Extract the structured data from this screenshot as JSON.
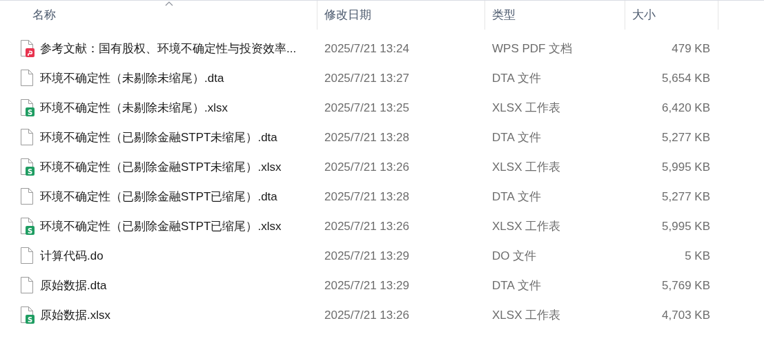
{
  "columns": [
    {
      "label": "名称",
      "sorted": true
    },
    {
      "label": "修改日期",
      "sorted": false
    },
    {
      "label": "类型",
      "sorted": false
    },
    {
      "label": "大小",
      "sorted": false
    }
  ],
  "files": [
    {
      "kind": "pdf",
      "name": "参考文献：国有股权、环境不确定性与投资效率...",
      "modified": "2025/7/21 13:24",
      "type": "WPS PDF 文档",
      "size": "479 KB"
    },
    {
      "kind": "file",
      "name": "环境不确定性（未剔除未缩尾）.dta",
      "modified": "2025/7/21 13:27",
      "type": "DTA 文件",
      "size": "5,654 KB"
    },
    {
      "kind": "sheet",
      "icon_text": "S",
      "name": "环境不确定性（未剔除未缩尾）.xlsx",
      "modified": "2025/7/21 13:25",
      "type": "XLSX 工作表",
      "size": "6,420 KB"
    },
    {
      "kind": "file",
      "name": "环境不确定性（已剔除金融STPT未缩尾）.dta",
      "modified": "2025/7/21 13:28",
      "type": "DTA 文件",
      "size": "5,277 KB"
    },
    {
      "kind": "sheet",
      "icon_text": "S",
      "name": "环境不确定性（已剔除金融STPT未缩尾）.xlsx",
      "modified": "2025/7/21 13:26",
      "type": "XLSX 工作表",
      "size": "5,995 KB"
    },
    {
      "kind": "file",
      "name": "环境不确定性（已剔除金融STPT已缩尾）.dta",
      "modified": "2025/7/21 13:28",
      "type": "DTA 文件",
      "size": "5,277 KB"
    },
    {
      "kind": "sheet",
      "icon_text": "S",
      "name": "环境不确定性（已剔除金融STPT已缩尾）.xlsx",
      "modified": "2025/7/21 13:26",
      "type": "XLSX 工作表",
      "size": "5,995 KB"
    },
    {
      "kind": "file",
      "name": "计算代码.do",
      "modified": "2025/7/21 13:29",
      "type": "DO 文件",
      "size": "5 KB"
    },
    {
      "kind": "file",
      "name": "原始数据.dta",
      "modified": "2025/7/21 13:29",
      "type": "DTA 文件",
      "size": "5,769 KB"
    },
    {
      "kind": "sheet",
      "icon_text": "S",
      "name": "原始数据.xlsx",
      "modified": "2025/7/21 13:26",
      "type": "XLSX 工作表",
      "size": "4,703 KB"
    }
  ]
}
